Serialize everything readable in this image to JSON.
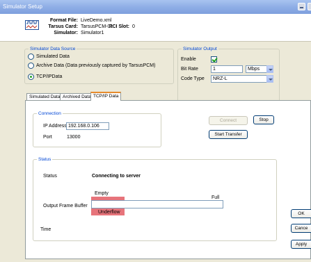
{
  "window": {
    "title": "Simulator Setup"
  },
  "header": {
    "format_file_label": "Format File:",
    "format_file_value": "LiveDemo.xml",
    "tarsus_card_label": "Tarsus Card:",
    "tarsus_card_value": "TarsusPCM-01",
    "simulator_label": "Simulator:",
    "simulator_value": "Simulator1",
    "pci_slot_label": "PCI Slot:",
    "pci_slot_value": "0"
  },
  "data_source": {
    "title": "Simulator Data Source",
    "options": [
      {
        "label": "Simulated Data",
        "checked": false
      },
      {
        "label": "Archive Data (Data previously captured by TarsusPCM)",
        "checked": false
      },
      {
        "label": "TCP/IPData",
        "checked": true
      }
    ]
  },
  "output": {
    "title": "Simulator Output",
    "enable_label": "Enable",
    "enable_checked": true,
    "bit_rate_label": "Bit Rate",
    "bit_rate_value": "1",
    "bit_rate_unit": "Mbps",
    "code_type_label": "Code Type",
    "code_type_value": "NRZ-L"
  },
  "tabs": [
    {
      "label": "Simulated Data",
      "active": false
    },
    {
      "label": "Archived Data",
      "active": false
    },
    {
      "label": "TCP/IP Data",
      "active": true
    }
  ],
  "connection": {
    "title": "Connection",
    "ip_label": "IP Address",
    "ip_value": "192.168.0.106",
    "port_label": "Port",
    "port_value": "13000",
    "connect_label": "Connect",
    "stop_label": "Stop",
    "start_transfer_label": "Start Transfer"
  },
  "status": {
    "title": "Status",
    "status_label": "Status",
    "status_value": "Connecting to server",
    "empty_label": "Empty",
    "full_label": "Full",
    "buffer_label": "Output Frame Buffer",
    "buffer_fill": 0,
    "underflow_label": "Underflow",
    "time_label": "Time"
  },
  "dialog_buttons": {
    "ok": "OK",
    "cancel": "Cance",
    "apply": "Apply"
  },
  "colors": {
    "accent_blue": "#0046D5",
    "indicator_red": "#E7747B",
    "tab_highlight": "#E68B2C"
  }
}
